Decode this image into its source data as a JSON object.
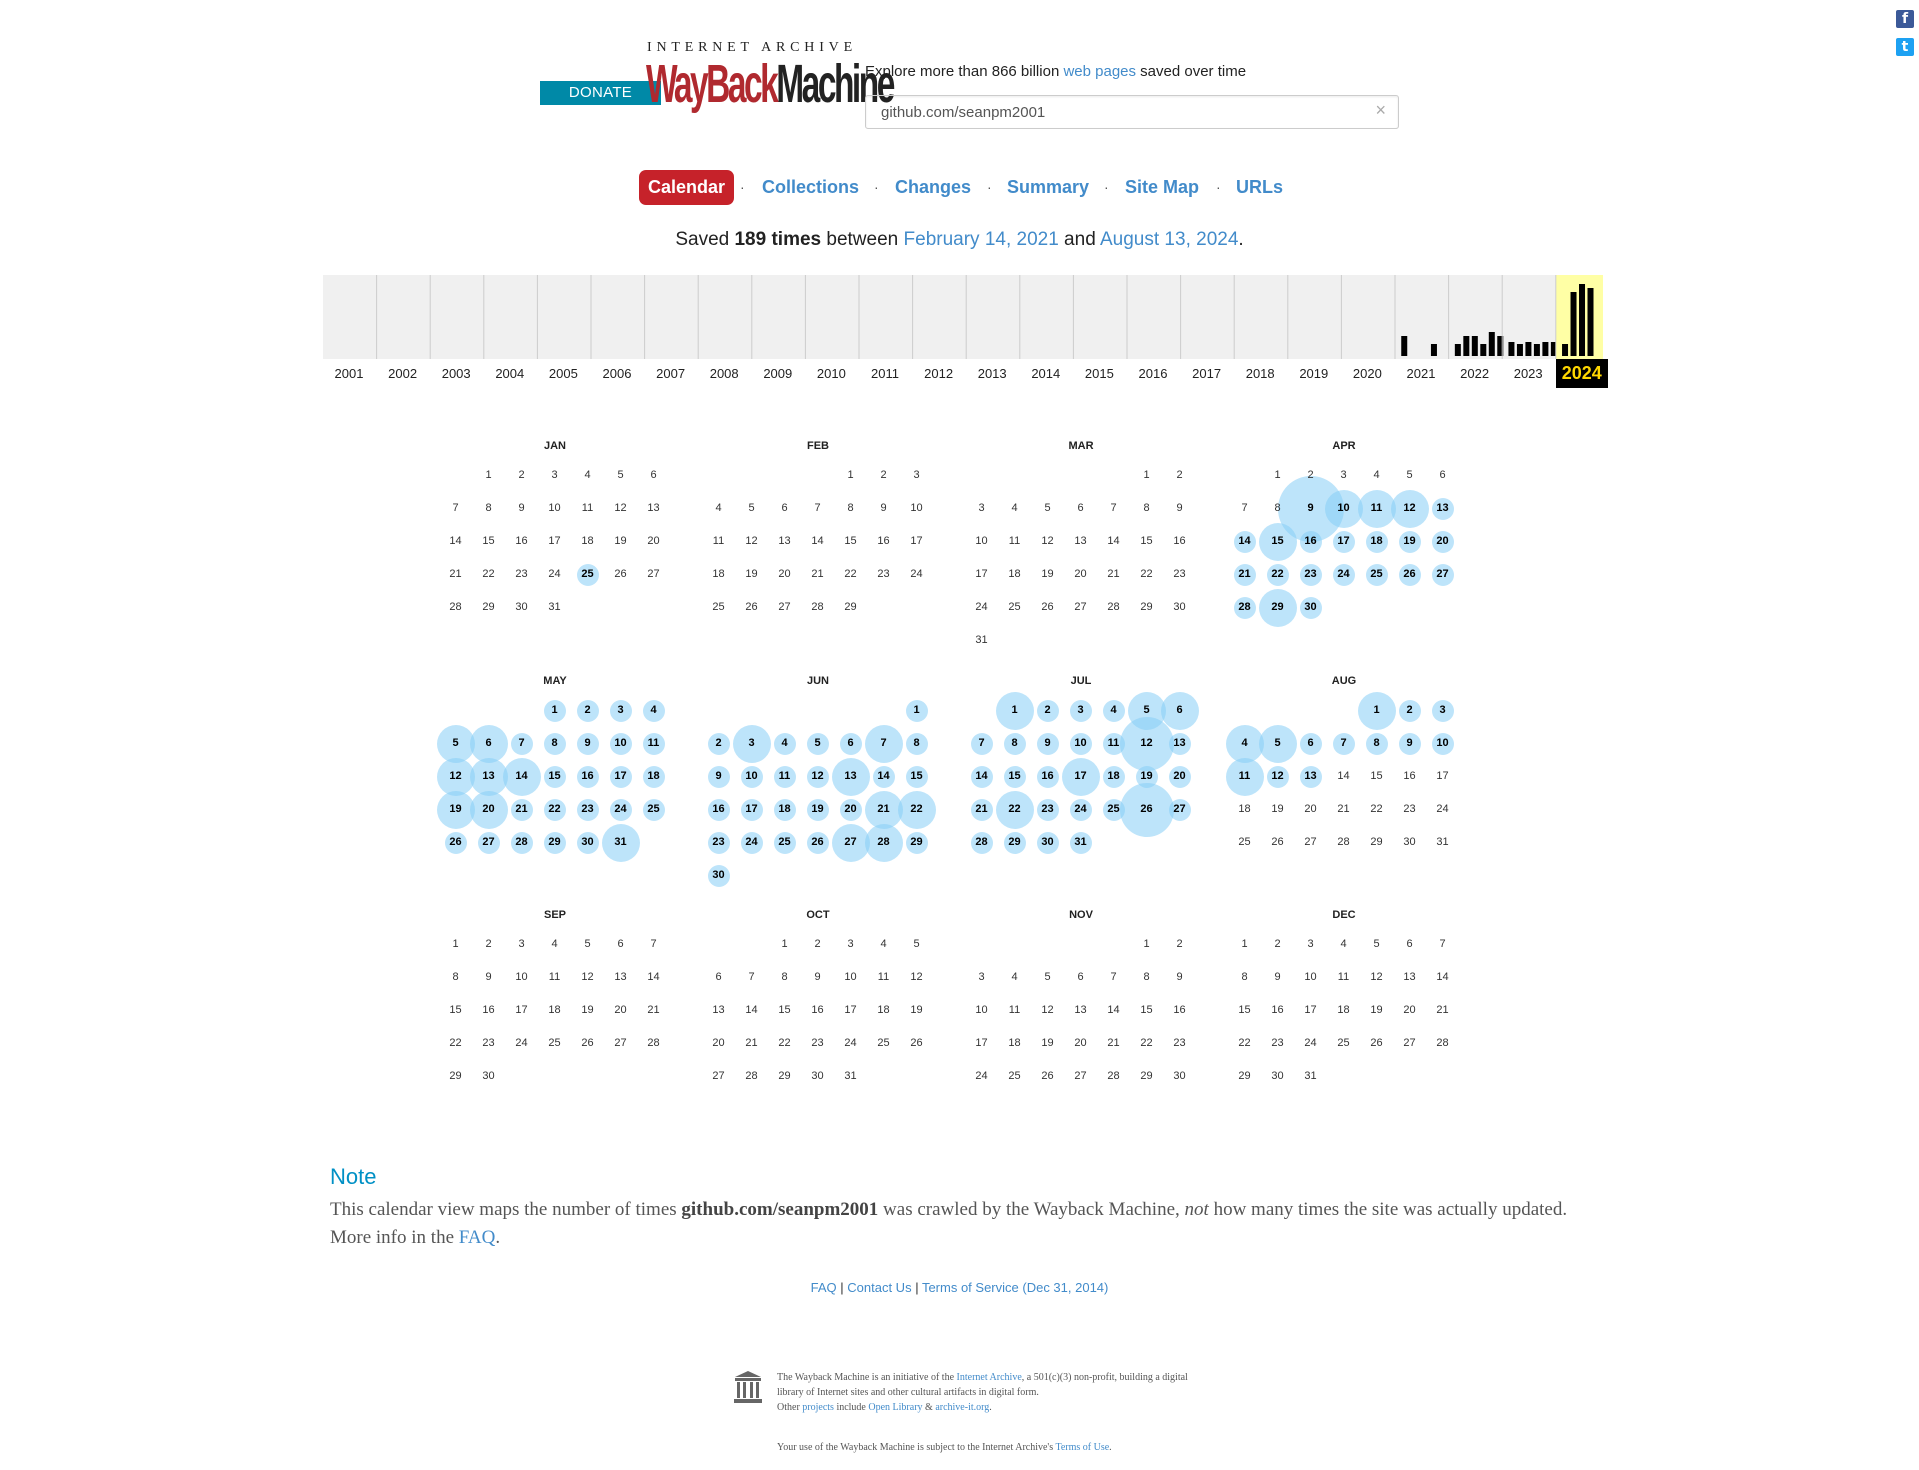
{
  "header": {
    "donate_label": "DONATE",
    "logo_top": "INTERNET ARCHIVE",
    "logo_way": "WayBack",
    "logo_machine": "Machine",
    "explore_prefix": "Explore more than 866 billion ",
    "explore_link": "web pages",
    "explore_suffix": " saved over time",
    "search_value": "github.com/seanpm2001",
    "clear_glyph": "×"
  },
  "social": {
    "facebook_glyph": "f",
    "twitter_glyph": "t"
  },
  "tabs": [
    {
      "label": "Calendar",
      "active": true
    },
    {
      "label": "Collections"
    },
    {
      "label": "Changes"
    },
    {
      "label": "Summary"
    },
    {
      "label": "Site Map"
    },
    {
      "label": "URLs"
    }
  ],
  "tab_separator": "·",
  "saved": {
    "prefix": "Saved ",
    "count": "189 times",
    "between": " between ",
    "first": "February 14, 2021",
    "and": " and ",
    "last": "August 13, 2024",
    "end": "."
  },
  "sparkline": {
    "years": [
      "2001",
      "2002",
      "2003",
      "2004",
      "2005",
      "2006",
      "2007",
      "2008",
      "2009",
      "2010",
      "2011",
      "2012",
      "2013",
      "2014",
      "2015",
      "2016",
      "2017",
      "2018",
      "2019",
      "2020",
      "2021",
      "2022",
      "2023",
      "2024"
    ],
    "selected_year": "2024",
    "highlight_color": "#ffffa5",
    "monthly_counts": {
      "2021": [
        0,
        20,
        0,
        0,
        0,
        0,
        0,
        0,
        12,
        0,
        0,
        0
      ],
      "2022": [
        0,
        12,
        0,
        20,
        0,
        20,
        0,
        12,
        0,
        24,
        0,
        20
      ],
      "2023": [
        0,
        14,
        0,
        12,
        0,
        14,
        0,
        12,
        0,
        14,
        0,
        14
      ],
      "2024": [
        0,
        12,
        0,
        64,
        0,
        72,
        0,
        68,
        0,
        0,
        0,
        0
      ]
    }
  },
  "calendar": {
    "year": "2024",
    "months": [
      {
        "name": "JAN",
        "start": 1,
        "days": 31,
        "captures": {
          "25": 1
        }
      },
      {
        "name": "FEB",
        "start": 4,
        "days": 29,
        "captures": {}
      },
      {
        "name": "MAR",
        "start": 5,
        "days": 31,
        "captures": {}
      },
      {
        "name": "APR",
        "start": 1,
        "days": 30,
        "captures": {
          "9": 5,
          "10": 2,
          "11": 2,
          "12": 2,
          "13": 1,
          "14": 1,
          "15": 2,
          "16": 1,
          "17": 1,
          "18": 1,
          "19": 1,
          "20": 1,
          "21": 1,
          "22": 1,
          "23": 1,
          "24": 1,
          "25": 1,
          "26": 1,
          "27": 1,
          "28": 1,
          "29": 2,
          "30": 1
        }
      },
      {
        "name": "MAY",
        "start": 3,
        "days": 31,
        "captures": {
          "1": 1,
          "2": 1,
          "3": 1,
          "4": 1,
          "5": 2,
          "6": 2,
          "7": 1,
          "8": 1,
          "9": 1,
          "10": 1,
          "11": 1,
          "12": 2,
          "13": 2,
          "14": 2,
          "15": 1,
          "16": 1,
          "17": 1,
          "18": 1,
          "19": 2,
          "20": 2,
          "21": 1,
          "22": 1,
          "23": 1,
          "24": 1,
          "25": 1,
          "26": 1,
          "27": 1,
          "28": 1,
          "29": 1,
          "30": 1,
          "31": 2
        }
      },
      {
        "name": "JUN",
        "start": 6,
        "days": 30,
        "captures": {
          "1": 1,
          "2": 1,
          "3": 2,
          "4": 1,
          "5": 1,
          "6": 1,
          "7": 2,
          "8": 1,
          "9": 1,
          "10": 1,
          "11": 1,
          "12": 1,
          "13": 2,
          "14": 1,
          "15": 1,
          "16": 1,
          "17": 1,
          "18": 1,
          "19": 1,
          "20": 1,
          "21": 2,
          "22": 2,
          "23": 1,
          "24": 1,
          "25": 1,
          "26": 1,
          "27": 2,
          "28": 2,
          "29": 1,
          "30": 1
        }
      },
      {
        "name": "JUL",
        "start": 1,
        "days": 31,
        "captures": {
          "1": 2,
          "2": 1,
          "3": 1,
          "4": 1,
          "5": 2,
          "6": 2,
          "7": 1,
          "8": 1,
          "9": 1,
          "10": 1,
          "11": 1,
          "12": 4,
          "13": 1,
          "14": 1,
          "15": 1,
          "16": 1,
          "17": 2,
          "18": 1,
          "19": 1,
          "20": 1,
          "21": 1,
          "22": 2,
          "23": 1,
          "24": 1,
          "25": 1,
          "26": 4,
          "27": 1,
          "28": 1,
          "29": 1,
          "30": 1,
          "31": 1
        }
      },
      {
        "name": "AUG",
        "start": 4,
        "days": 31,
        "captures": {
          "1": 2,
          "2": 1,
          "3": 1,
          "4": 2,
          "5": 2,
          "6": 1,
          "7": 1,
          "8": 1,
          "9": 1,
          "10": 1,
          "11": 2,
          "12": 1,
          "13": 1
        }
      },
      {
        "name": "SEP",
        "start": 0,
        "days": 30,
        "captures": {}
      },
      {
        "name": "OCT",
        "start": 2,
        "days": 31,
        "captures": {}
      },
      {
        "name": "NOV",
        "start": 5,
        "days": 30,
        "captures": {}
      },
      {
        "name": "DEC",
        "start": 0,
        "days": 31,
        "captures": {}
      }
    ]
  },
  "note": {
    "title": "Note",
    "t1": "This calendar view maps the number of times ",
    "url": "github.com/seanpm2001",
    "t2": " was crawled by the Wayback Machine, ",
    "not": "not",
    "t3": " how many times the site was actually updated.",
    "t4": "More info in the ",
    "faq": "FAQ",
    "t5": "."
  },
  "footer_links": {
    "faq": "FAQ",
    "sep": " | ",
    "contact": "Contact Us",
    "tos": "Terms of Service (Dec 31, 2014)"
  },
  "ia_footer": {
    "l1a": "The Wayback Machine is an initiative of the ",
    "l1b": "Internet Archive",
    "l1c": ", a 501(c)(3) non-profit, building a digital library of Internet sites and other cultural artifacts in digital form.",
    "l2a": "Other ",
    "l2b": "projects",
    "l2c": " include ",
    "l2d": "Open Library",
    "l2e": " & ",
    "l2f": "archive-it.org",
    "l2g": ".",
    "l3a": "Your use of the Wayback Machine is subject to the Internet Archive's ",
    "l3b": "Terms of Use",
    "l3c": "."
  }
}
